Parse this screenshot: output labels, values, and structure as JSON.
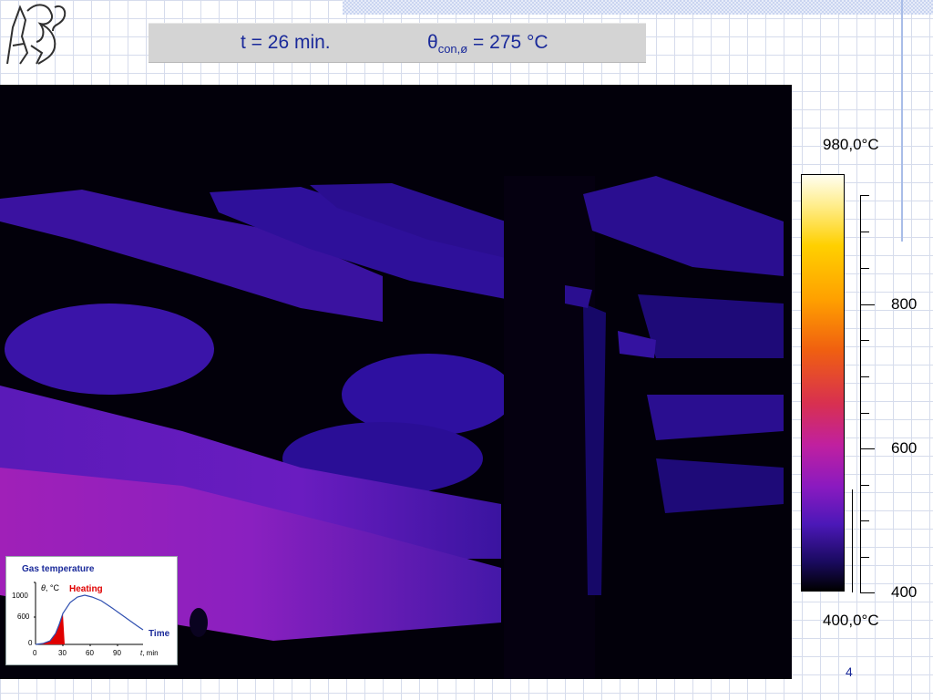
{
  "title": {
    "time": "t = 26 min.",
    "symbol": "θ",
    "subscript": "con,ø",
    "value": " = 275 °C"
  },
  "scale": {
    "max_label": "980,0°C",
    "min_label": "400,0°C",
    "ticks": [
      "800",
      "600",
      "400"
    ]
  },
  "inset": {
    "title": "Gas temperature",
    "heating": "Heating",
    "ylabel_symbol": "θ",
    "ylabel_unit": ", °C",
    "time_label": "Time",
    "y_ticks": [
      "1000",
      "600",
      "0"
    ],
    "x_ticks": [
      "0",
      "30",
      "60",
      "90"
    ],
    "x_unit_symbol": "t",
    "x_unit": ", min"
  },
  "page_number": "4",
  "colors": {
    "title_text": "#1a2a9a",
    "heating": "#e00000",
    "curve": "#2f4fb0"
  }
}
